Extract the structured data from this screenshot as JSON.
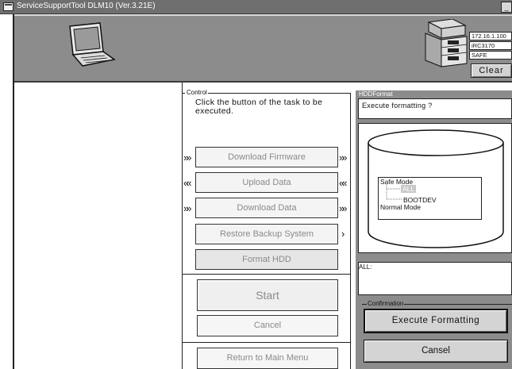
{
  "window": {
    "title": "ServiceSupportTool DLM10 (Ver.3.21E)"
  },
  "header": {
    "ip_address": "172.16.1.100",
    "device_model": "iRC3170",
    "mode": "SAFE",
    "clear_label": "Clear"
  },
  "control": {
    "group_label": "Control",
    "instructions": "Click the button of the task to be executed.",
    "buttons": {
      "download_firmware": "Download Firmware",
      "upload_data": "Upload Data",
      "download_data": "Download Data",
      "restore_backup": "Restore Backup System",
      "format_hdd": "Format HDD"
    },
    "start_label": "Start",
    "cancel_label": "Cancel",
    "return_label": "Return to Main Menu"
  },
  "hdd_format": {
    "group_label": "HDDFormat",
    "message": "Execute formatting ?",
    "tree": [
      "Safe  Mode",
      "ALL",
      "BOOTDEV",
      "Normal  Mode"
    ],
    "all_label": "ALL:",
    "confirmation_label": "Confirmation",
    "execute_label": "Execute Formatting",
    "cansel_label": "Cansel"
  },
  "icons": [
    "app-icon",
    "laptop-icon",
    "copier-icon",
    "forward-arrows-icon",
    "back-arrows-icon",
    "chevron-right-icon",
    "disk-icon"
  ]
}
